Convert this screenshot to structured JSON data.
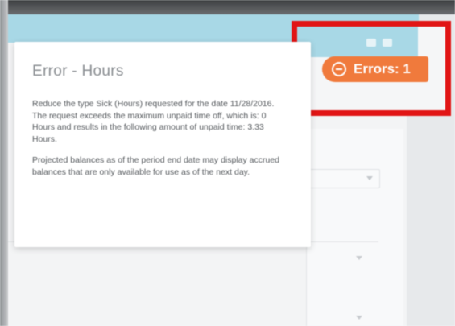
{
  "popover": {
    "title": "Error - Hours",
    "paragraphs": [
      "Reduce the type Sick (Hours) requested for the date 11/28/2016. The request exceeds the maximum unpaid time off, which is: 0 Hours and results in the following amount of unpaid time: 3.33 Hours.",
      "Projected balances as of the period end date may display accrued balances that are only available for use as of the next day."
    ]
  },
  "errors_badge": {
    "label": "Errors: 1",
    "color": "#f07a3c",
    "icon": "minus-circle-icon"
  },
  "highlight": {
    "color": "#e11515"
  },
  "accent_color": "#a8d8e6"
}
